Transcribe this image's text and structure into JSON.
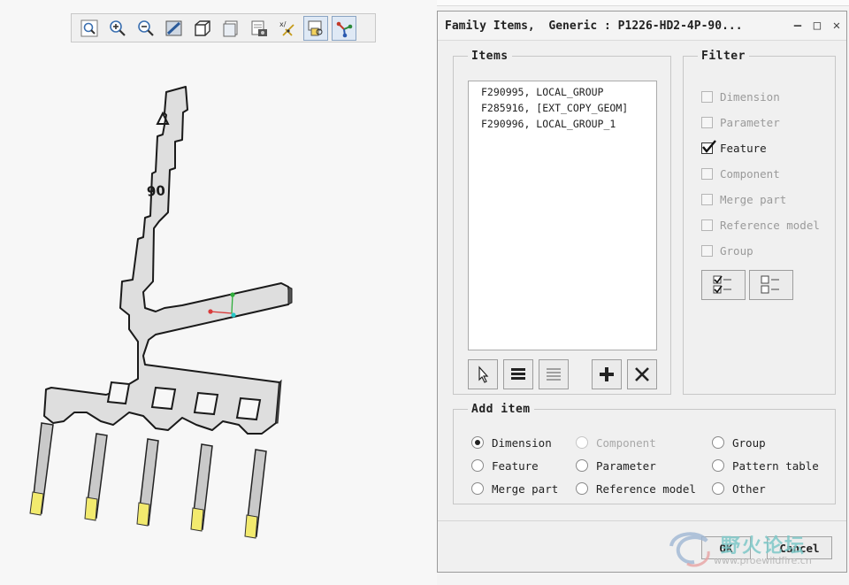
{
  "toolbar": {
    "buttons": [
      {
        "name": "refit-icon",
        "active": false
      },
      {
        "name": "zoom-in-icon",
        "active": false
      },
      {
        "name": "zoom-out-icon",
        "active": false
      },
      {
        "name": "repaint-icon",
        "active": false
      },
      {
        "name": "display-style-icon",
        "active": false
      },
      {
        "name": "saved-orientations-icon",
        "active": false
      },
      {
        "name": "view-manager-icon",
        "active": false
      },
      {
        "name": "datum-display-icon",
        "active": false
      },
      {
        "name": "annotation-display-icon",
        "active": true
      },
      {
        "name": "spin-center-icon",
        "active": true
      }
    ]
  },
  "model": {
    "tab_label": "90"
  },
  "dialog": {
    "title": "Family Items,  Generic : P1226-HD2-4P-90...",
    "items_legend": "Items",
    "items": [
      "F290995, LOCAL_GROUP",
      "F285916, [EXT_COPY_GEOM]",
      "F290996, LOCAL_GROUP_1"
    ],
    "filter_legend": "Filter",
    "filters": [
      {
        "label": "Dimension",
        "checked": false,
        "enabled": false
      },
      {
        "label": "Parameter",
        "checked": false,
        "enabled": false
      },
      {
        "label": "Feature",
        "checked": true,
        "enabled": true
      },
      {
        "label": "Component",
        "checked": false,
        "enabled": false
      },
      {
        "label": "Merge part",
        "checked": false,
        "enabled": false
      },
      {
        "label": "Reference model",
        "checked": false,
        "enabled": false
      },
      {
        "label": "Group",
        "checked": false,
        "enabled": false
      }
    ],
    "add_item_legend": "Add item",
    "add_options": [
      {
        "label": "Dimension",
        "selected": true,
        "enabled": true
      },
      {
        "label": "Component",
        "selected": false,
        "enabled": false
      },
      {
        "label": "Group",
        "selected": false,
        "enabled": true
      },
      {
        "label": "Feature",
        "selected": false,
        "enabled": true
      },
      {
        "label": "Parameter",
        "selected": false,
        "enabled": true
      },
      {
        "label": "Pattern table",
        "selected": false,
        "enabled": true
      },
      {
        "label": "Merge part",
        "selected": false,
        "enabled": true
      },
      {
        "label": "Reference model",
        "selected": false,
        "enabled": true
      },
      {
        "label": "Other",
        "selected": false,
        "enabled": true
      }
    ],
    "ok_label": "OK",
    "cancel_label": "Cancel"
  },
  "watermark": {
    "text": "野火论坛",
    "url": "www.proewildfire.cn"
  }
}
